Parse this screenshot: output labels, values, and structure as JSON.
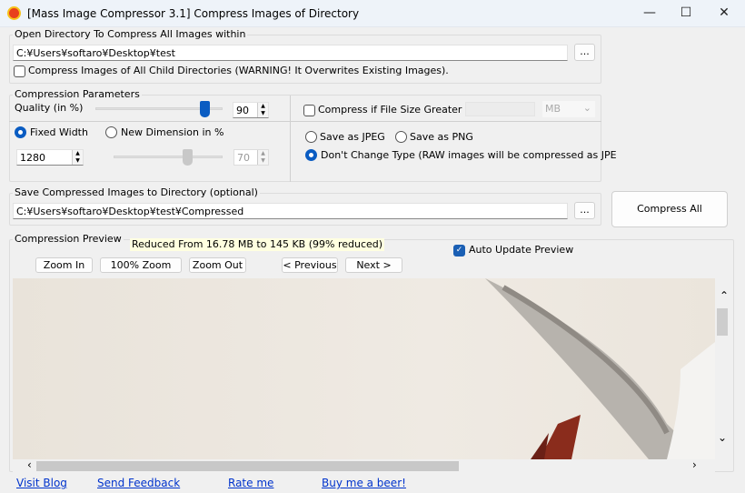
{
  "window": {
    "title": "[Mass Image Compressor 3.1] Compress Images of Directory",
    "minimize": "—",
    "maximize": "☐",
    "close": "✕"
  },
  "open_dir": {
    "legend": "Open Directory To Compress All Images within",
    "path": "C:¥Users¥softaro¥Desktop¥test",
    "browse": "...",
    "child_dirs_label": "Compress Images of All Child Directories (WARNING! It Overwrites Existing Images).",
    "child_dirs_checked": false
  },
  "params": {
    "legend": "Compression Parameters",
    "quality_label": "Quality (in %)",
    "quality": "90",
    "quality_value": 90,
    "fixed_width_label": "Fixed Width",
    "fixed_width_selected": true,
    "new_dim_label": "New Dimension in %",
    "width": "1280",
    "dimension": "70",
    "dimension_value": 70,
    "size_check_label": "Compress if File Size Greater tha",
    "size_checked": false,
    "size_value": "",
    "size_unit": "MB",
    "save_jpeg": "Save as JPEG",
    "save_png": "Save as PNG",
    "dont_change": "Don't Change Type (RAW images will be compressed as JPE",
    "selected_type": "dont_change"
  },
  "save_dir": {
    "legend": "Save Compressed Images to Directory (optional)",
    "path": "C:¥Users¥softaro¥Desktop¥test¥Compressed",
    "browse": "..."
  },
  "compress_all": "Compress All",
  "preview": {
    "legend": "Compression Preview",
    "reduced": "Reduced From 16.78 MB to 145 KB (99% reduced)",
    "auto_update": "Auto Update Preview",
    "auto_update_checked": true,
    "zoom_in": "Zoom In",
    "zoom_100": "100% Zoom",
    "zoom_out": "Zoom Out",
    "previous": "< Previous",
    "next": "Next >"
  },
  "links": [
    "Visit Blog",
    "Send Feedback",
    "Rate me",
    "Buy me a beer!"
  ]
}
